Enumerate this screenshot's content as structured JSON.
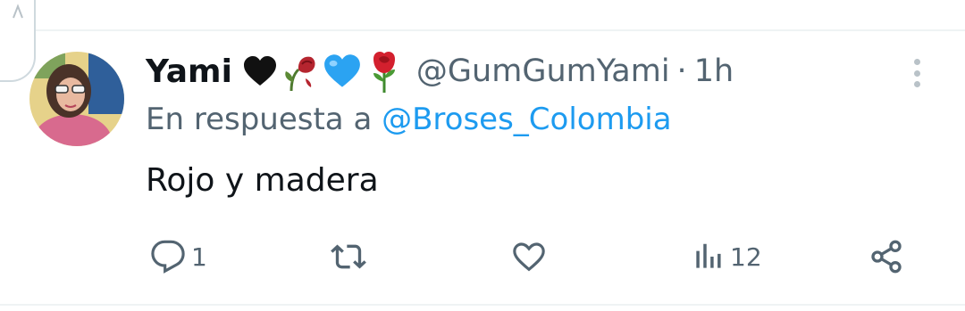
{
  "author": {
    "display_name": "Yami",
    "name_emojis": [
      "black-heart",
      "wilted-flower",
      "blue-heart",
      "rose"
    ],
    "handle": "@GumGumYami",
    "separator": "·",
    "time": "1h"
  },
  "reply_context": {
    "prefix": "En respuesta a",
    "handle": "@Broses_Colombia"
  },
  "tweet": {
    "text": "Rojo y madera"
  },
  "actions": {
    "reply_count": "1",
    "retweet_count": "",
    "like_count": "",
    "views_count": "12"
  },
  "icons": {
    "more": "more-vertical-icon",
    "reply": "reply-icon",
    "retweet": "retweet-icon",
    "like": "like-icon",
    "views": "views-icon",
    "share": "share-icon"
  },
  "colors": {
    "text_primary": "#0f1419",
    "text_secondary": "#536471",
    "link": "#1d9bf0",
    "divider": "#eff3f4"
  }
}
